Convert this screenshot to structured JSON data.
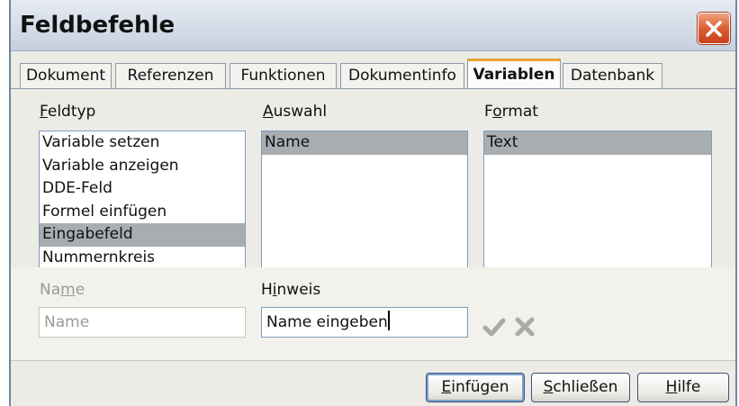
{
  "window": {
    "title": "Feldbefehle"
  },
  "tabs": [
    {
      "label": "Dokument",
      "active": false
    },
    {
      "label": "Referenzen",
      "active": false
    },
    {
      "label": "Funktionen",
      "active": false
    },
    {
      "label": "Dokumentinfo",
      "active": false
    },
    {
      "label": "Variablen",
      "active": true
    },
    {
      "label": "Datenbank",
      "active": false
    }
  ],
  "feldtyp": {
    "mnemonic": "F",
    "label_rest": "eldtyp",
    "items": [
      "Variable setzen",
      "Variable anzeigen",
      "DDE-Feld",
      "Formel einfügen",
      "Eingabefeld",
      "Nummernkreis"
    ],
    "selected": "Eingabefeld"
  },
  "auswahl": {
    "mnemonic": "A",
    "label_rest": "uswahl",
    "items": [
      "Name"
    ],
    "selected": "Name"
  },
  "format": {
    "label_pre": "F",
    "mnemonic": "o",
    "label_rest": "rmat",
    "items": [
      "Text"
    ],
    "selected": "Text"
  },
  "name_field": {
    "label_pre": "Na",
    "mnemonic": "m",
    "label_rest": "e",
    "value": "Name",
    "enabled": false
  },
  "hinweis_field": {
    "label_pre": "H",
    "mnemonic": "i",
    "label_rest": "nweis",
    "value": "Name eingeben"
  },
  "icons": {
    "apply": "checkmark-icon",
    "remove": "x-icon",
    "close": "close-icon"
  },
  "buttons": {
    "insert": {
      "mnemonic": "E",
      "rest": "infügen"
    },
    "close": {
      "mnemonic": "S",
      "rest": "chließen"
    },
    "help": {
      "mnemonic": "H",
      "rest": "ilfe"
    }
  },
  "colors": {
    "accent_tab": "#e8a531",
    "close_button": "#dc5a31",
    "selection": "#a9adb2"
  }
}
